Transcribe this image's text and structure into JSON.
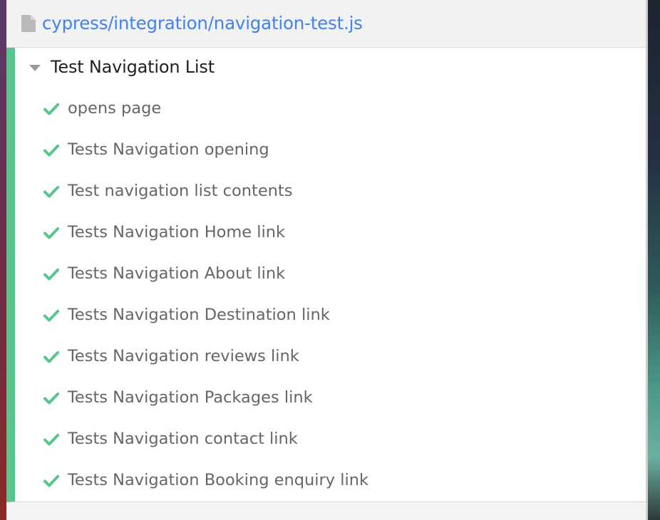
{
  "colors": {
    "accent_blue": "#3f82f0",
    "pass_green": "#58c58c",
    "test_text": "#666666",
    "suite_text": "#222222"
  },
  "spec": {
    "icon": "file-icon",
    "path": "cypress/integration/navigation-test.js"
  },
  "suite": {
    "icon": "caret-down-icon",
    "title": "Test Navigation List",
    "tests": [
      {
        "title": "opens page",
        "status": "passed",
        "icon": "check-icon"
      },
      {
        "title": "Tests Navigation opening",
        "status": "passed",
        "icon": "check-icon"
      },
      {
        "title": "Test navigation list contents",
        "status": "passed",
        "icon": "check-icon"
      },
      {
        "title": "Tests Navigation Home link",
        "status": "passed",
        "icon": "check-icon"
      },
      {
        "title": "Tests Navigation About link",
        "status": "passed",
        "icon": "check-icon"
      },
      {
        "title": "Tests Navigation Destination link",
        "status": "passed",
        "icon": "check-icon"
      },
      {
        "title": "Tests Navigation reviews link",
        "status": "passed",
        "icon": "check-icon"
      },
      {
        "title": "Tests Navigation Packages link",
        "status": "passed",
        "icon": "check-icon"
      },
      {
        "title": "Tests Navigation contact link",
        "status": "passed",
        "icon": "check-icon"
      },
      {
        "title": "Tests Navigation Booking enquiry link",
        "status": "passed",
        "icon": "check-icon"
      }
    ]
  }
}
